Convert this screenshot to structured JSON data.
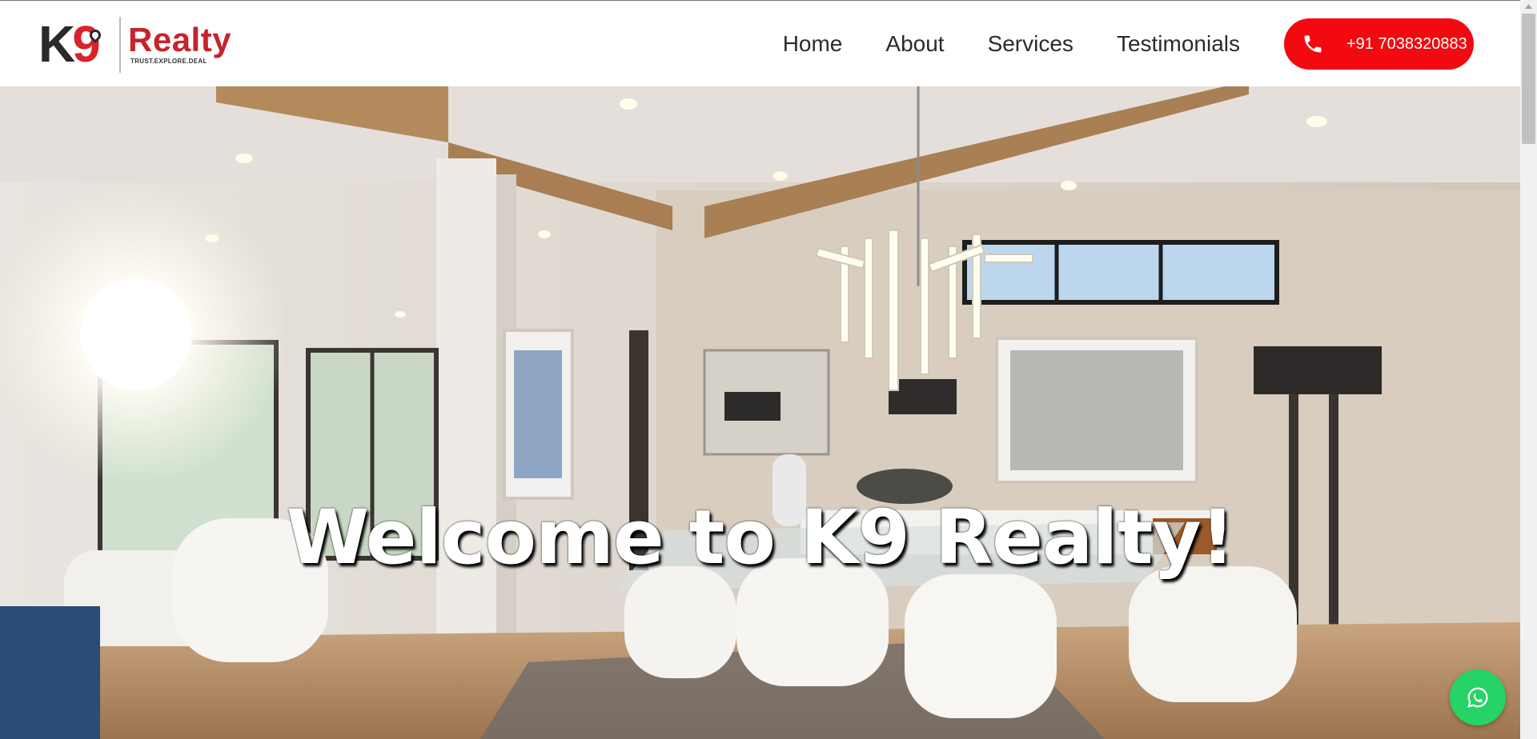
{
  "header": {
    "logo": {
      "brand_k": "K",
      "brand_nine": "9",
      "brand_name": "Realty",
      "tagline": "TRUST.EXPLORE.DEAL"
    },
    "nav": [
      {
        "label": "Home"
      },
      {
        "label": "About"
      },
      {
        "label": "Services"
      },
      {
        "label": "Testimonials"
      }
    ],
    "call_button": {
      "label": "+91 7038320883",
      "icon": "phone-icon",
      "color": "#f20a10"
    }
  },
  "hero": {
    "title": "Welcome to K9 Realty!"
  },
  "whatsapp_button": {
    "icon": "whatsapp-icon",
    "color": "#25d366"
  },
  "colors": {
    "brand_red": "#c8232c",
    "text_dark": "#2b2b2b"
  }
}
